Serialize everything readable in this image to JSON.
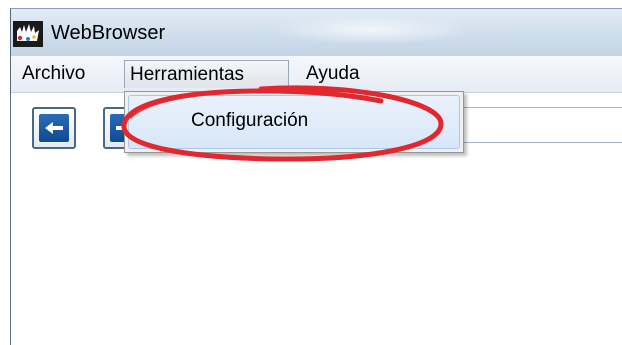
{
  "window": {
    "title": "WebBrowser",
    "app_icon": "webbrowser-app-icon"
  },
  "menubar": {
    "items": [
      {
        "label": "Archivo"
      },
      {
        "label": "Herramientas"
      },
      {
        "label": "Ayuda"
      }
    ],
    "open_menu": "Herramientas"
  },
  "dropdown": {
    "items": [
      {
        "label": "Configuración",
        "highlighted": true
      }
    ]
  },
  "toolbar": {
    "back_icon": "arrow-left-icon",
    "forward_icon": "arrow-right-icon",
    "address": ""
  },
  "annotation": {
    "color": "#e0282e",
    "target": "Configuración"
  }
}
